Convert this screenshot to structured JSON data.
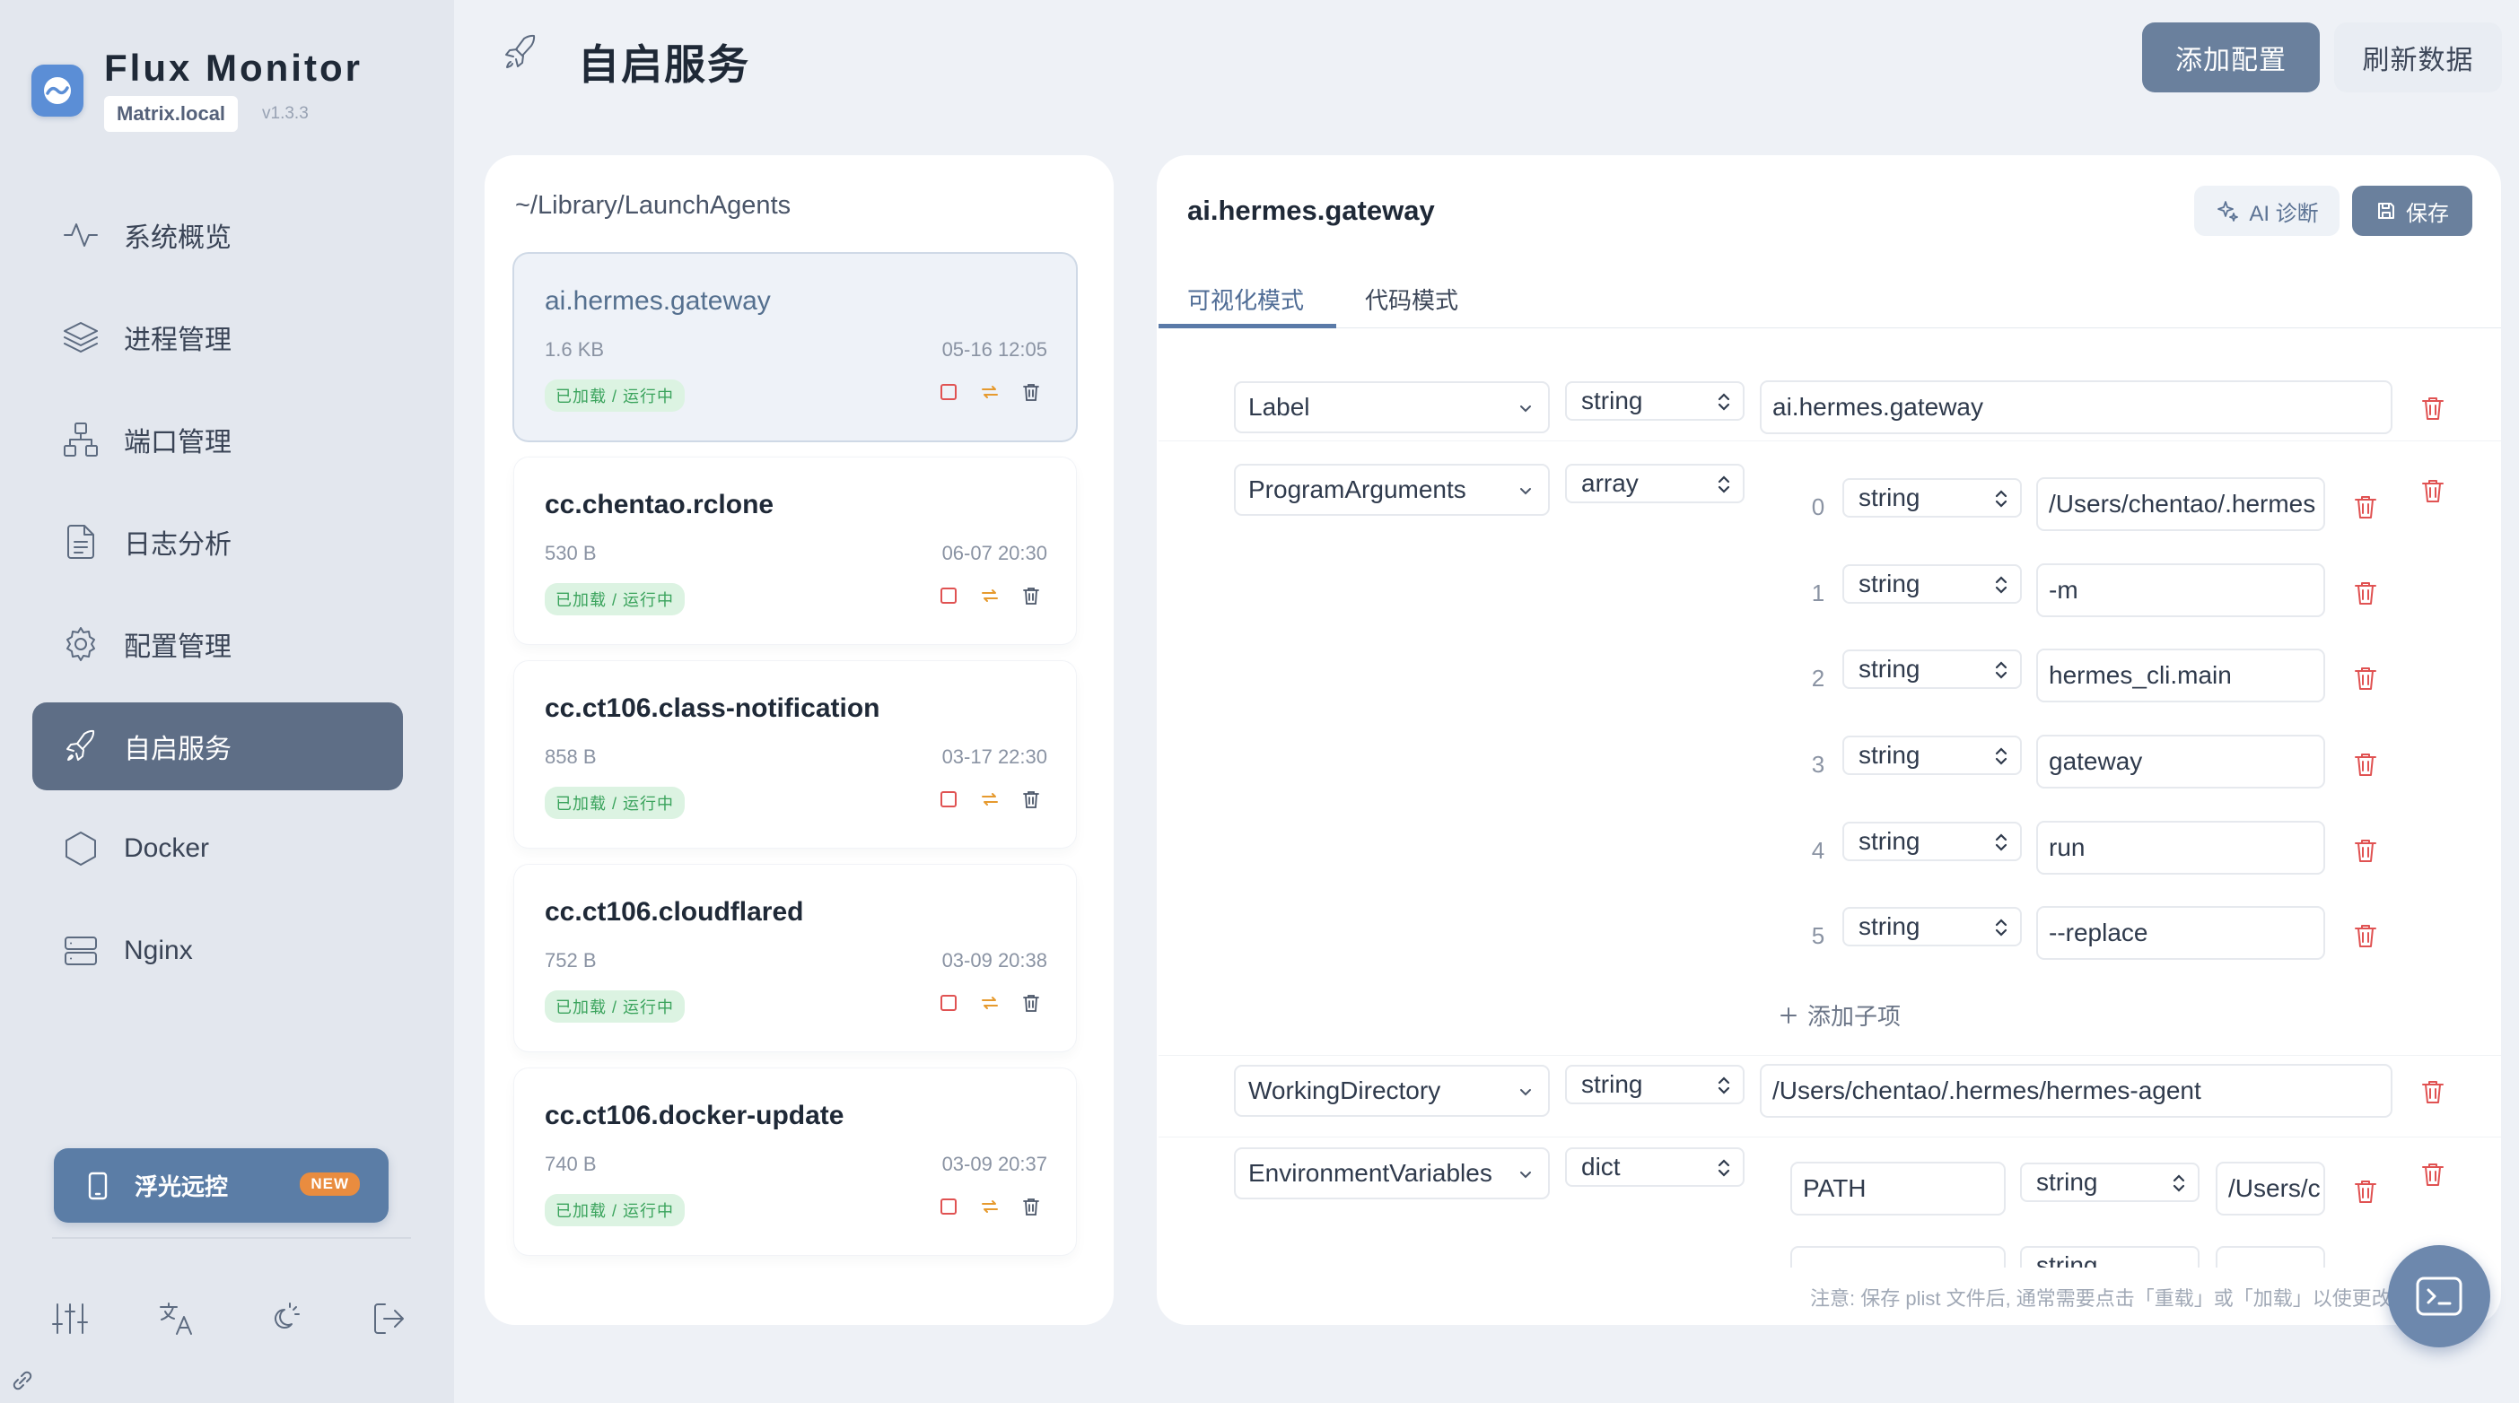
{
  "app": {
    "title": "Flux Monitor",
    "host": "Matrix.local",
    "version": "v1.3.3"
  },
  "nav": {
    "items": [
      {
        "label": "系统概览",
        "icon": "activity-icon"
      },
      {
        "label": "进程管理",
        "icon": "layers-icon"
      },
      {
        "label": "端口管理",
        "icon": "network-icon"
      },
      {
        "label": "日志分析",
        "icon": "file-text-icon"
      },
      {
        "label": "配置管理",
        "icon": "gear-icon"
      },
      {
        "label": "自启服务",
        "icon": "rocket-icon",
        "active": true
      },
      {
        "label": "Docker",
        "icon": "hexagon-icon"
      },
      {
        "label": "Nginx",
        "icon": "server-icon"
      }
    ],
    "remote": {
      "label": "浮光远控",
      "badge": "NEW"
    }
  },
  "header": {
    "title": "自启服务",
    "add_label": "添加配置",
    "refresh_label": "刷新数据"
  },
  "list": {
    "path": "~/Library/LaunchAgents",
    "files": [
      {
        "name": "ai.hermes.gateway",
        "size": "1.6 KB",
        "date": "05-16 12:05",
        "status": "已加载 / 运行中"
      },
      {
        "name": "cc.chentao.rclone",
        "size": "530 B",
        "date": "06-07 20:30",
        "status": "已加载 / 运行中"
      },
      {
        "name": "cc.ct106.class-notification",
        "size": "858 B",
        "date": "03-17 22:30",
        "status": "已加载 / 运行中"
      },
      {
        "name": "cc.ct106.cloudflared",
        "size": "752 B",
        "date": "03-09 20:38",
        "status": "已加载 / 运行中"
      },
      {
        "name": "cc.ct106.docker-update",
        "size": "740 B",
        "date": "03-09 20:37",
        "status": "已加载 / 运行中"
      }
    ]
  },
  "editor": {
    "title": "ai.hermes.gateway",
    "ai_label": "AI 诊断",
    "save_label": "保存",
    "tabs": [
      "可视化模式",
      "代码模式"
    ],
    "entries": {
      "label": {
        "key": "Label",
        "type": "string",
        "value": "ai.hermes.gateway"
      },
      "program_args": {
        "key": "ProgramArguments",
        "type": "array",
        "items": [
          {
            "index": "0",
            "type": "string",
            "value": "/Users/chentao/.hermes"
          },
          {
            "index": "1",
            "type": "string",
            "value": "-m"
          },
          {
            "index": "2",
            "type": "string",
            "value": "hermes_cli.main"
          },
          {
            "index": "3",
            "type": "string",
            "value": "gateway"
          },
          {
            "index": "4",
            "type": "string",
            "value": "run"
          },
          {
            "index": "5",
            "type": "string",
            "value": "--replace"
          }
        ],
        "add_child_label": "添加子项"
      },
      "working_dir": {
        "key": "WorkingDirectory",
        "type": "string",
        "value": "/Users/chentao/.hermes/hermes-agent"
      },
      "env": {
        "key": "EnvironmentVariables",
        "type": "dict",
        "items": [
          {
            "key": "PATH",
            "type": "string",
            "value": "/Users/c"
          },
          {
            "key": "",
            "type": "string",
            "value": ""
          }
        ]
      }
    },
    "footnote": "注意: 保存 plist 文件后, 通常需要点击「重载」或「加载」以使更改"
  },
  "colors": {
    "accent": "#6a809d",
    "active_nav": "#5e6e86",
    "danger": "#e05252",
    "success": "#3aa35c",
    "badge": "#e98c3f",
    "sync": "#e69a2e"
  }
}
